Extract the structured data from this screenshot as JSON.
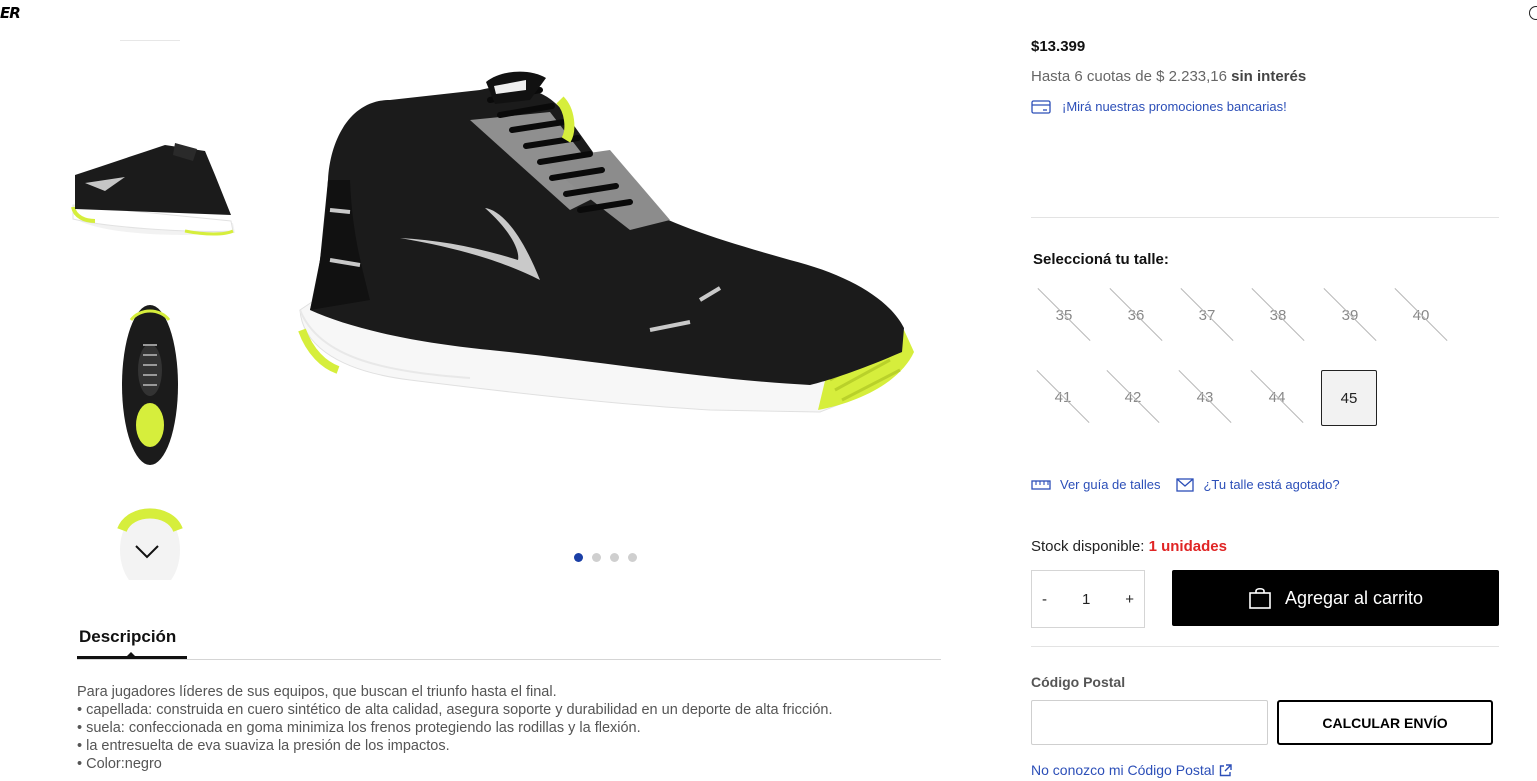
{
  "header": {
    "logo_text": "ER"
  },
  "gallery": {
    "thumbnails": [
      {
        "name": "thumb-side-view"
      },
      {
        "name": "thumb-top-view"
      },
      {
        "name": "thumb-sole-view"
      }
    ],
    "dots_count": 4,
    "active_dot": 0
  },
  "description": {
    "tab_label": "Descripción",
    "lines": [
      "Para jugadores líderes de sus equipos, que buscan el triunfo hasta el final.",
      "• capellada: construida en cuero sintético de alta calidad, asegura soporte y durabilidad en un deporte de alta fricción.",
      "• suela: confeccionada en goma minimiza los frenos protegiendo las rodillas y la flexión.",
      "• la entresuelta de eva suaviza la presión de los impactos.",
      "• Color:negro"
    ]
  },
  "product": {
    "price": "$13.399",
    "installments_prefix": "Hasta 6 cuotas de $ 2.233,16 ",
    "installments_bold": "sin interés",
    "promo_link": "¡Mirá nuestras promociones bancarias!",
    "size_title": "Seleccioná tu talle:",
    "sizes": [
      {
        "label": "35",
        "available": false
      },
      {
        "label": "36",
        "available": false
      },
      {
        "label": "37",
        "available": false
      },
      {
        "label": "38",
        "available": false
      },
      {
        "label": "39",
        "available": false
      },
      {
        "label": "40",
        "available": false
      },
      {
        "label": "41",
        "available": false
      },
      {
        "label": "42",
        "available": false
      },
      {
        "label": "43",
        "available": false
      },
      {
        "label": "44",
        "available": false
      },
      {
        "label": "45",
        "available": true,
        "selected": true
      }
    ],
    "size_guide_link": "Ver guía de talles",
    "out_of_stock_link": "¿Tu talle está agotado?",
    "stock_label": "Stock disponible: ",
    "stock_value": "1 unidades",
    "quantity": "1",
    "qty_minus": "-",
    "qty_plus": "+",
    "add_to_cart": "Agregar al carrito"
  },
  "shipping": {
    "label": "Código Postal",
    "input_value": "",
    "calc_button": "CALCULAR ENVÍO",
    "unknown_cp_link": "No conozco mi Código Postal"
  },
  "colors": {
    "accent_blue": "#2c4fb8",
    "stock_red": "#e02525",
    "shoe_black": "#1b1b1b",
    "shoe_lime": "#d6ee3c"
  }
}
